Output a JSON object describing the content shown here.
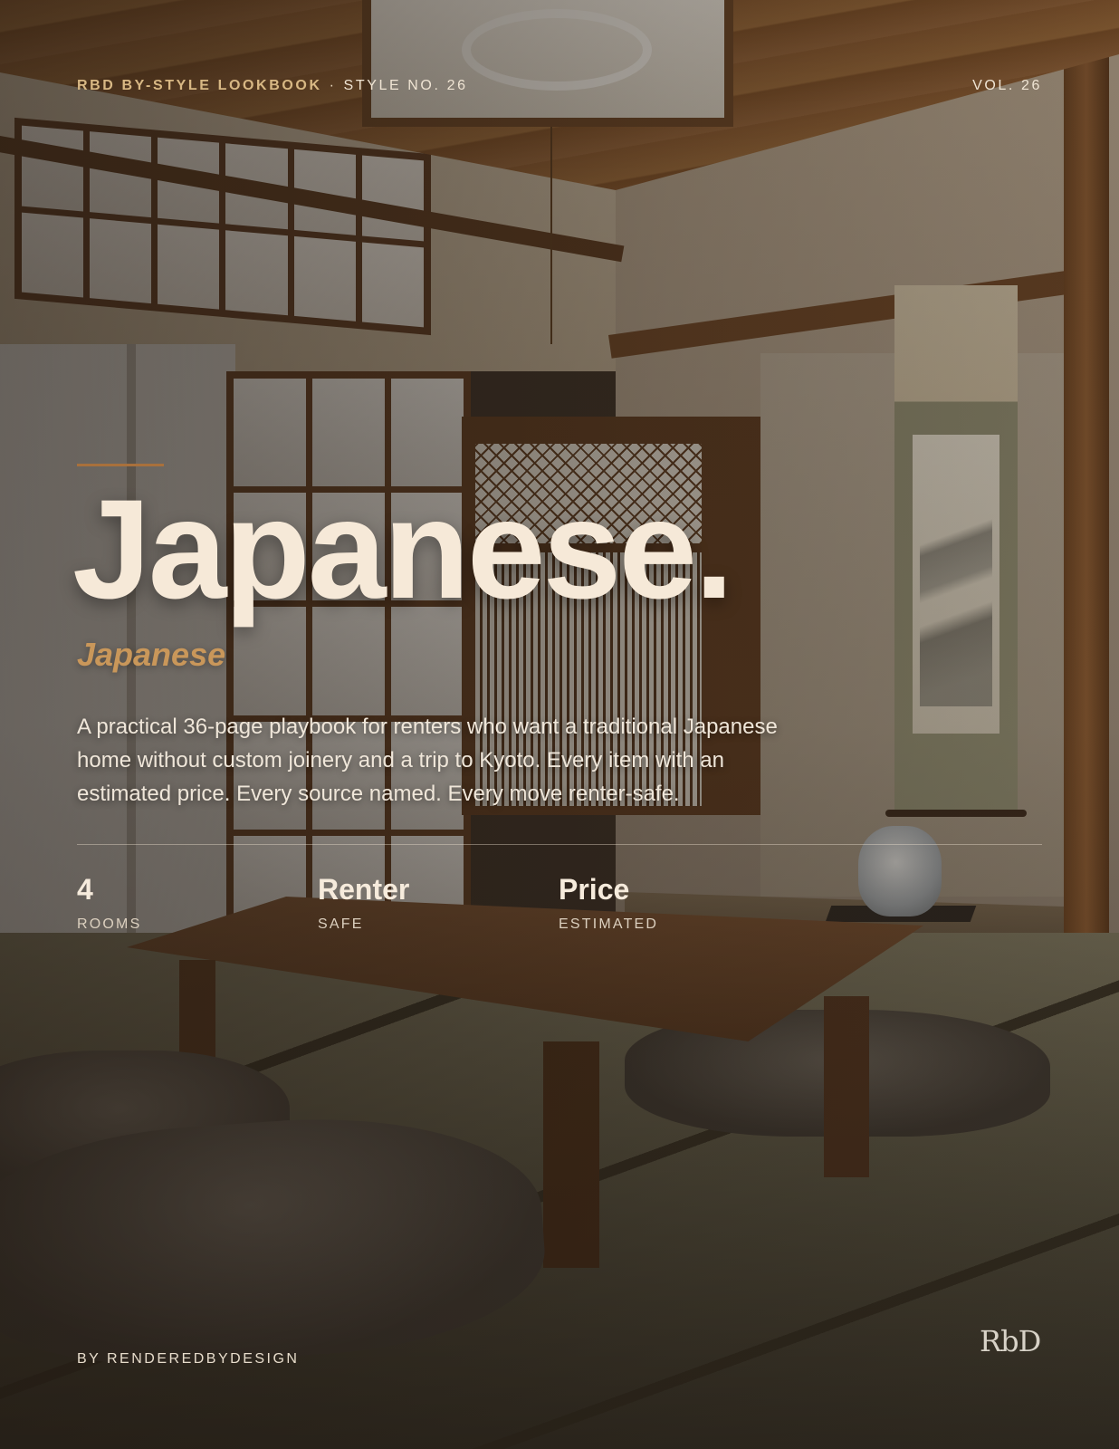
{
  "header": {
    "brand": "RBD BY-STYLE LOOKBOOK",
    "separator": "·",
    "style_number": "STYLE NO. 26",
    "volume": "VOL. 26"
  },
  "hero": {
    "title": "Japanese.",
    "subtitle": "Japanese",
    "description": "A practical 36-page playbook for renters who want a traditional Japanese home without custom joinery and a trip to Kyoto. Every item with an estimated price. Every source named. Every move renter-safe."
  },
  "stats": [
    {
      "value": "4",
      "label": "ROOMS"
    },
    {
      "value": "Renter",
      "label": "SAFE"
    },
    {
      "value": "Price",
      "label": "ESTIMATED"
    }
  ],
  "footer": {
    "byline": "BY RENDEREDBYDESIGN",
    "logo_text": "RbD"
  },
  "colors": {
    "accent_gold": "#d8b884",
    "accent_rust": "#a8703c",
    "title_cream": "#f6e9d8"
  }
}
